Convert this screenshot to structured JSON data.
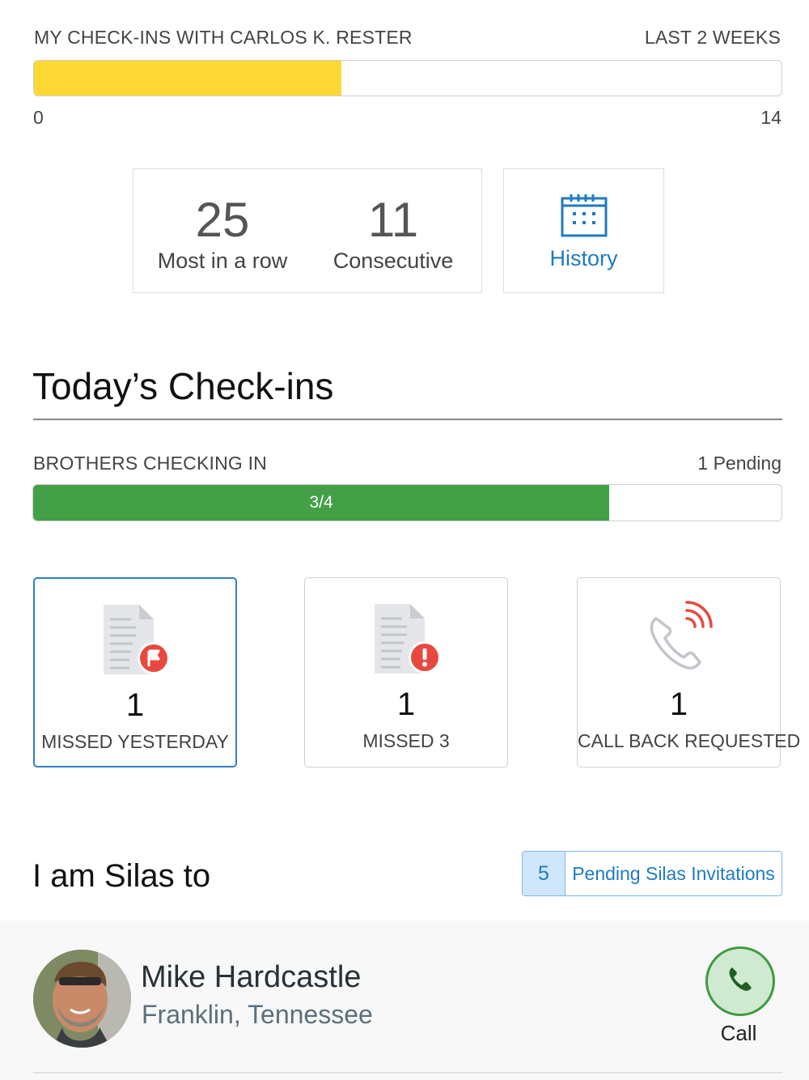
{
  "top_progress": {
    "title": "MY CHECK-INS WITH CARLOS K. RESTER",
    "range_label": "LAST 2 WEEKS",
    "min_label": "0",
    "max_label": "14",
    "value": 5.75,
    "max": 14,
    "color": "#fdd835"
  },
  "stats": {
    "most_in_a_row": {
      "value": "25",
      "label": "Most in a row"
    },
    "consecutive": {
      "value": "11",
      "label": "Consecutive"
    },
    "history_label": "History",
    "history_icon": "calendar-icon"
  },
  "today": {
    "title": "Today’s Check-ins",
    "brothers_label": "BROTHERS CHECKING IN",
    "pending_label": "1 Pending",
    "progress_text": "3/4",
    "progress_fraction": 0.77,
    "progress_color": "#43a047"
  },
  "cards": [
    {
      "count": "1",
      "label": "MISSED YESTERDAY",
      "icon": "document-flag-icon",
      "selected": true
    },
    {
      "count": "1",
      "label": "MISSED 3",
      "icon": "document-alert-icon",
      "selected": false
    },
    {
      "count": "1",
      "label": "CALL BACK REQUESTED",
      "icon": "phone-ringing-icon",
      "selected": false
    }
  ],
  "silas": {
    "title": "I am Silas to",
    "invite_count": "5",
    "invite_label": "Pending Silas Invitations"
  },
  "contact": {
    "name": "Mike Hardcastle",
    "location": "Franklin, Tennessee",
    "call_label": "Call",
    "call_color": "#3f9a44"
  }
}
